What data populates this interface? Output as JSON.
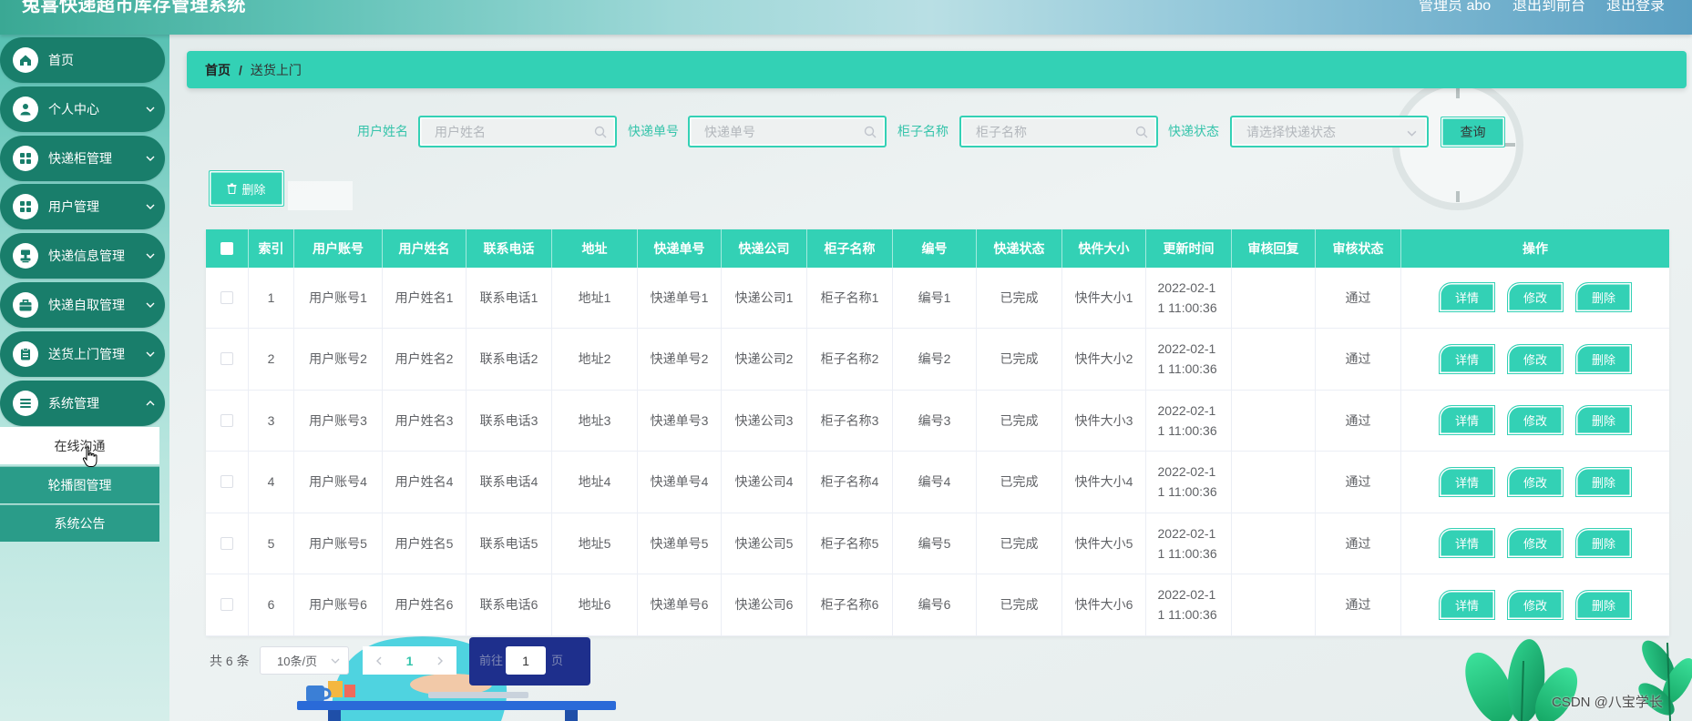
{
  "header": {
    "title": "兔喜快递超市库存管理系统",
    "user": "管理员 abo",
    "to_front": "退出到前台",
    "logout": "退出登录"
  },
  "sidebar": {
    "items": [
      {
        "label": "首页",
        "icon": "home-icon",
        "expandable": false
      },
      {
        "label": "个人中心",
        "icon": "user-icon",
        "expandable": true
      },
      {
        "label": "快递柜管理",
        "icon": "grid-icon",
        "expandable": true
      },
      {
        "label": "用户管理",
        "icon": "grid-icon",
        "expandable": true
      },
      {
        "label": "快递信息管理",
        "icon": "stamp-icon",
        "expandable": true
      },
      {
        "label": "快递自取管理",
        "icon": "briefcase-icon",
        "expandable": true
      },
      {
        "label": "送货上门管理",
        "icon": "clipboard-icon",
        "expandable": true
      },
      {
        "label": "系统管理",
        "icon": "menu-icon",
        "expandable": true,
        "expanded": true
      }
    ],
    "submenu": [
      {
        "label": "在线沟通",
        "active": true
      },
      {
        "label": "轮播图管理",
        "active": false
      },
      {
        "label": "系统公告",
        "active": false
      }
    ]
  },
  "breadcrumb": {
    "home": "首页",
    "separator": "/",
    "current": "送货上门"
  },
  "search": {
    "fields": [
      {
        "label": "用户姓名",
        "placeholder": "用户姓名"
      },
      {
        "label": "快递单号",
        "placeholder": "快递单号"
      },
      {
        "label": "柜子名称",
        "placeholder": "柜子名称"
      }
    ],
    "status": {
      "label": "快递状态",
      "placeholder": "请选择快递状态"
    },
    "query_label": "查询"
  },
  "toolbar": {
    "delete_label": "删除"
  },
  "table": {
    "columns": [
      "索引",
      "用户账号",
      "用户姓名",
      "联系电话",
      "地址",
      "快递单号",
      "快递公司",
      "柜子名称",
      "编号",
      "快递状态",
      "快件大小",
      "更新时间",
      "审核回复",
      "审核状态",
      "操作"
    ],
    "rows": [
      {
        "index": "1",
        "account": "用户账号1",
        "name": "用户姓名1",
        "phone": "联系电话1",
        "address": "地址1",
        "tracking_no": "快递单号1",
        "company": "快递公司1",
        "locker": "柜子名称1",
        "number": "编号1",
        "status": "已完成",
        "size": "快件大小1",
        "updated": "2022-02-11 11:00:36",
        "review_reply": "",
        "review_status": "通过"
      },
      {
        "index": "2",
        "account": "用户账号2",
        "name": "用户姓名2",
        "phone": "联系电话2",
        "address": "地址2",
        "tracking_no": "快递单号2",
        "company": "快递公司2",
        "locker": "柜子名称2",
        "number": "编号2",
        "status": "已完成",
        "size": "快件大小2",
        "updated": "2022-02-11 11:00:36",
        "review_reply": "",
        "review_status": "通过"
      },
      {
        "index": "3",
        "account": "用户账号3",
        "name": "用户姓名3",
        "phone": "联系电话3",
        "address": "地址3",
        "tracking_no": "快递单号3",
        "company": "快递公司3",
        "locker": "柜子名称3",
        "number": "编号3",
        "status": "已完成",
        "size": "快件大小3",
        "updated": "2022-02-11 11:00:36",
        "review_reply": "",
        "review_status": "通过"
      },
      {
        "index": "4",
        "account": "用户账号4",
        "name": "用户姓名4",
        "phone": "联系电话4",
        "address": "地址4",
        "tracking_no": "快递单号4",
        "company": "快递公司4",
        "locker": "柜子名称4",
        "number": "编号4",
        "status": "已完成",
        "size": "快件大小4",
        "updated": "2022-02-11 11:00:36",
        "review_reply": "",
        "review_status": "通过"
      },
      {
        "index": "5",
        "account": "用户账号5",
        "name": "用户姓名5",
        "phone": "联系电话5",
        "address": "地址5",
        "tracking_no": "快递单号5",
        "company": "快递公司5",
        "locker": "柜子名称5",
        "number": "编号5",
        "status": "已完成",
        "size": "快件大小5",
        "updated": "2022-02-11 11:00:36",
        "review_reply": "",
        "review_status": "通过"
      },
      {
        "index": "6",
        "account": "用户账号6",
        "name": "用户姓名6",
        "phone": "联系电话6",
        "address": "地址6",
        "tracking_no": "快递单号6",
        "company": "快递公司6",
        "locker": "柜子名称6",
        "number": "编号6",
        "status": "已完成",
        "size": "快件大小6",
        "updated": "2022-02-11 11:00:36",
        "review_reply": "",
        "review_status": "通过"
      }
    ],
    "actions": [
      "详情",
      "修改",
      "删除"
    ]
  },
  "pagination": {
    "total": "共 6 条",
    "page_size": "10条/页",
    "current_page": "1",
    "goto_prefix": "前往",
    "goto_value": "1",
    "goto_suffix": "页"
  },
  "watermark": "CSDN @八宝学长",
  "colors": {
    "accent": "#33d1b5",
    "sidebar_item": "#197e6b",
    "submenu_item": "#2a9c89",
    "label_text": "#36c4ab",
    "cell_text": "#606266"
  }
}
